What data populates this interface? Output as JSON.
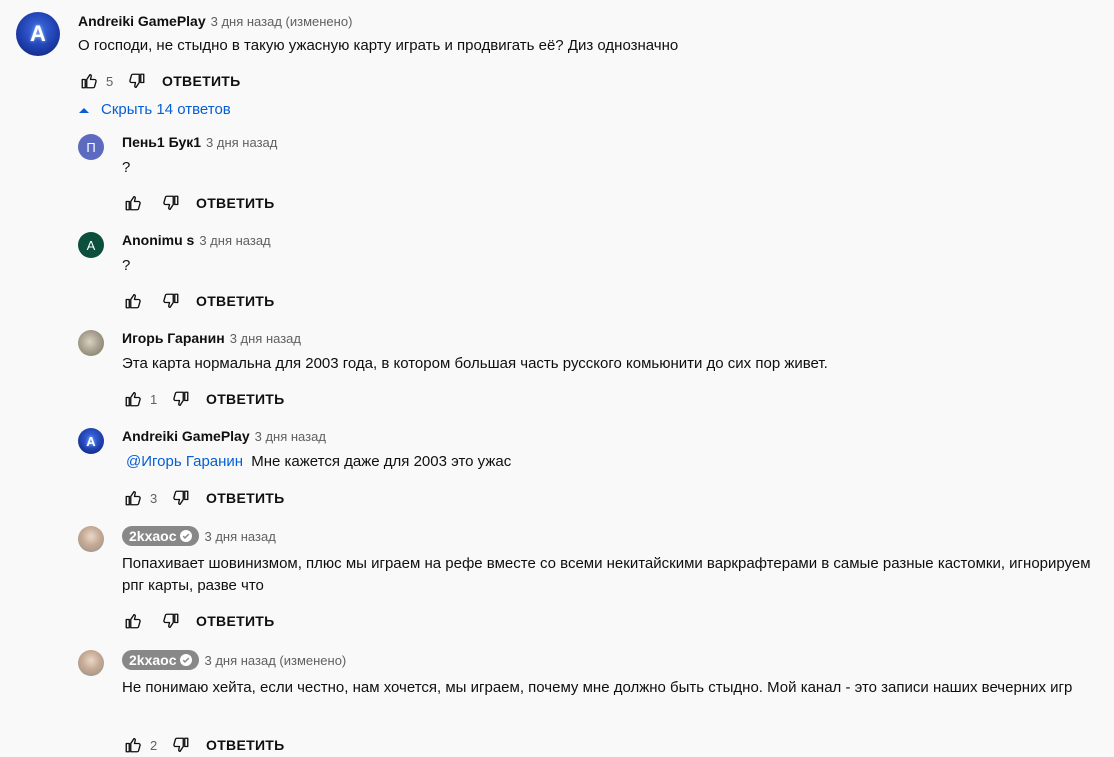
{
  "labels": {
    "reply": "ОТВЕТИТЬ",
    "hide_replies": "Скрыть 14 ответов"
  },
  "top_comment": {
    "avatar_letter": "A",
    "author": "Andreiki GamePlay",
    "time": "3 дня назад (изменено)",
    "text": "О господи, не стыдно в такую ужасную карту играть и продвигать её? Диз однозначно",
    "likes": "5"
  },
  "replies": [
    {
      "avatar_letter": "П",
      "author": "Пень1 Бук1",
      "time": "3 дня назад",
      "text": "?",
      "likes": ""
    },
    {
      "avatar_letter": "A",
      "author": "Anonimu s",
      "time": "3 дня назад",
      "text": "?",
      "likes": ""
    },
    {
      "avatar_letter": "",
      "author": "Игорь Гаранин",
      "time": "3 дня назад",
      "text": "Эта карта нормальна для 2003 года, в котором большая часть русского комьюнити до сих пор живет.",
      "likes": "1"
    },
    {
      "avatar_letter": "A",
      "author": "Andreiki GamePlay",
      "time": "3 дня назад",
      "mention": "@Игорь Гаранин",
      "text": "Мне кажется даже для 2003 это ужас",
      "likes": "3"
    },
    {
      "avatar_letter": "",
      "author": "2kxaoc",
      "time": "3 дня назад",
      "text": "Попахивает шовинизмом, плюс мы играем на рефе вместе со всеми некитайскими варкрафтерами в самые разные кастомки, игнорируем рпг карты, разве что",
      "likes": ""
    },
    {
      "avatar_letter": "",
      "author": "2kxaoc",
      "time": "3 дня назад (изменено)",
      "text": "Не понимаю хейта, если честно, нам хочется, мы играем, почему мне должно быть стыдно. Мой канал - это записи наших вечерних игр",
      "likes": "2"
    }
  ]
}
